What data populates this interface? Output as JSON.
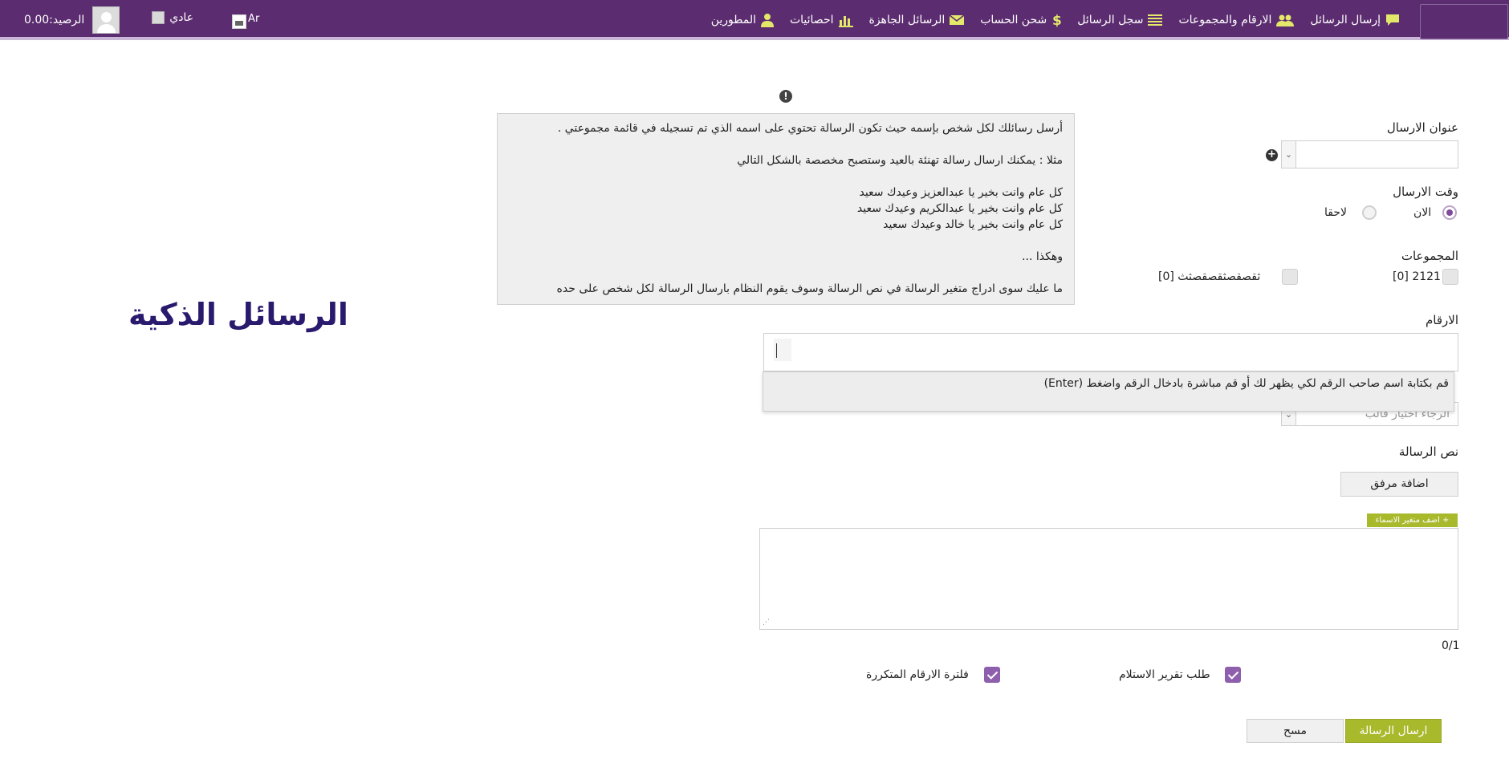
{
  "topbar": {
    "nav": [
      {
        "label": "إرسال الرسائل",
        "icon": "chat-bubble-icon"
      },
      {
        "label": "الارقام والمجموعات",
        "icon": "users-icon"
      },
      {
        "label": "سجل الرسائل",
        "icon": "list-icon"
      },
      {
        "label": "شحن الحساب",
        "icon": "dollar-icon"
      },
      {
        "label": "الرسائل الجاهزة",
        "icon": "envelope-icon"
      },
      {
        "label": "احصائيات",
        "icon": "bar-chart-icon"
      },
      {
        "label": "المطورين",
        "icon": "user-icon"
      }
    ],
    "balance": "الرصيد:0.00",
    "mode": "عادي",
    "lang": "Ar"
  },
  "page_title": "الرسائل الذكية",
  "help": {
    "lines": [
      "أرسل رسائلك لكل شخص بإسمه حيث تكون الرسالة تحتوي على اسمه الذي تم تسجيله في قائمة مجموعتي .",
      "",
      "مثلا : يمكنك ارسال رسالة تهنئة بالعيد وستصبح مخصصة بالشكل التالي",
      "",
      "كل عام وانت بخير يا عبدالعزيز وعيدك سعيد",
      "كل عام وانت بخير يا عبدالكريم وعيدك سعيد",
      "كل عام وانت بخير يا خالد وعيدك سعيد",
      "",
      "وهكذا ...",
      "",
      "ما عليك سوى ادراج متغير الرسالة في نص الرسالة وسوف يقوم النظام بارسال الرسالة لكل شخص على حده"
    ]
  },
  "form": {
    "sender_label": "عنوان الارسال",
    "send_time_label": "وقت الارسال",
    "send_now": "الان",
    "send_later": "لاحقا",
    "groups_label": "المجموعات",
    "groups": [
      {
        "name": "2121 [0]",
        "checked": false
      },
      {
        "name": "ثقصقصثقصقصثث [0]",
        "checked": false
      }
    ],
    "numbers_label": "الارقام",
    "numbers_hint": "قم بكتابة اسم صاحب الرقم لكي يظهر لك أو قم مباشرة بادخال الرقم واضغط (Enter)",
    "template_placeholder": "الرجاء اختيار قالب",
    "message_label": "نص الرسالة",
    "attach_label": "اضافة مرفق",
    "var_tag": "+ اضف متغير الاسماء",
    "counter": "0/1",
    "delivery_report": "طلب تقرير الاستلام",
    "filter_duplicates": "فلترة الارقام المتكررة",
    "send_button": "ارسال الرسالة",
    "clear_button": "مسح"
  },
  "colors": {
    "topbar": "#5b2c6f",
    "accent_green": "#a9b92c",
    "accent_purple": "#8e5fad",
    "title": "#2a1a6e"
  }
}
